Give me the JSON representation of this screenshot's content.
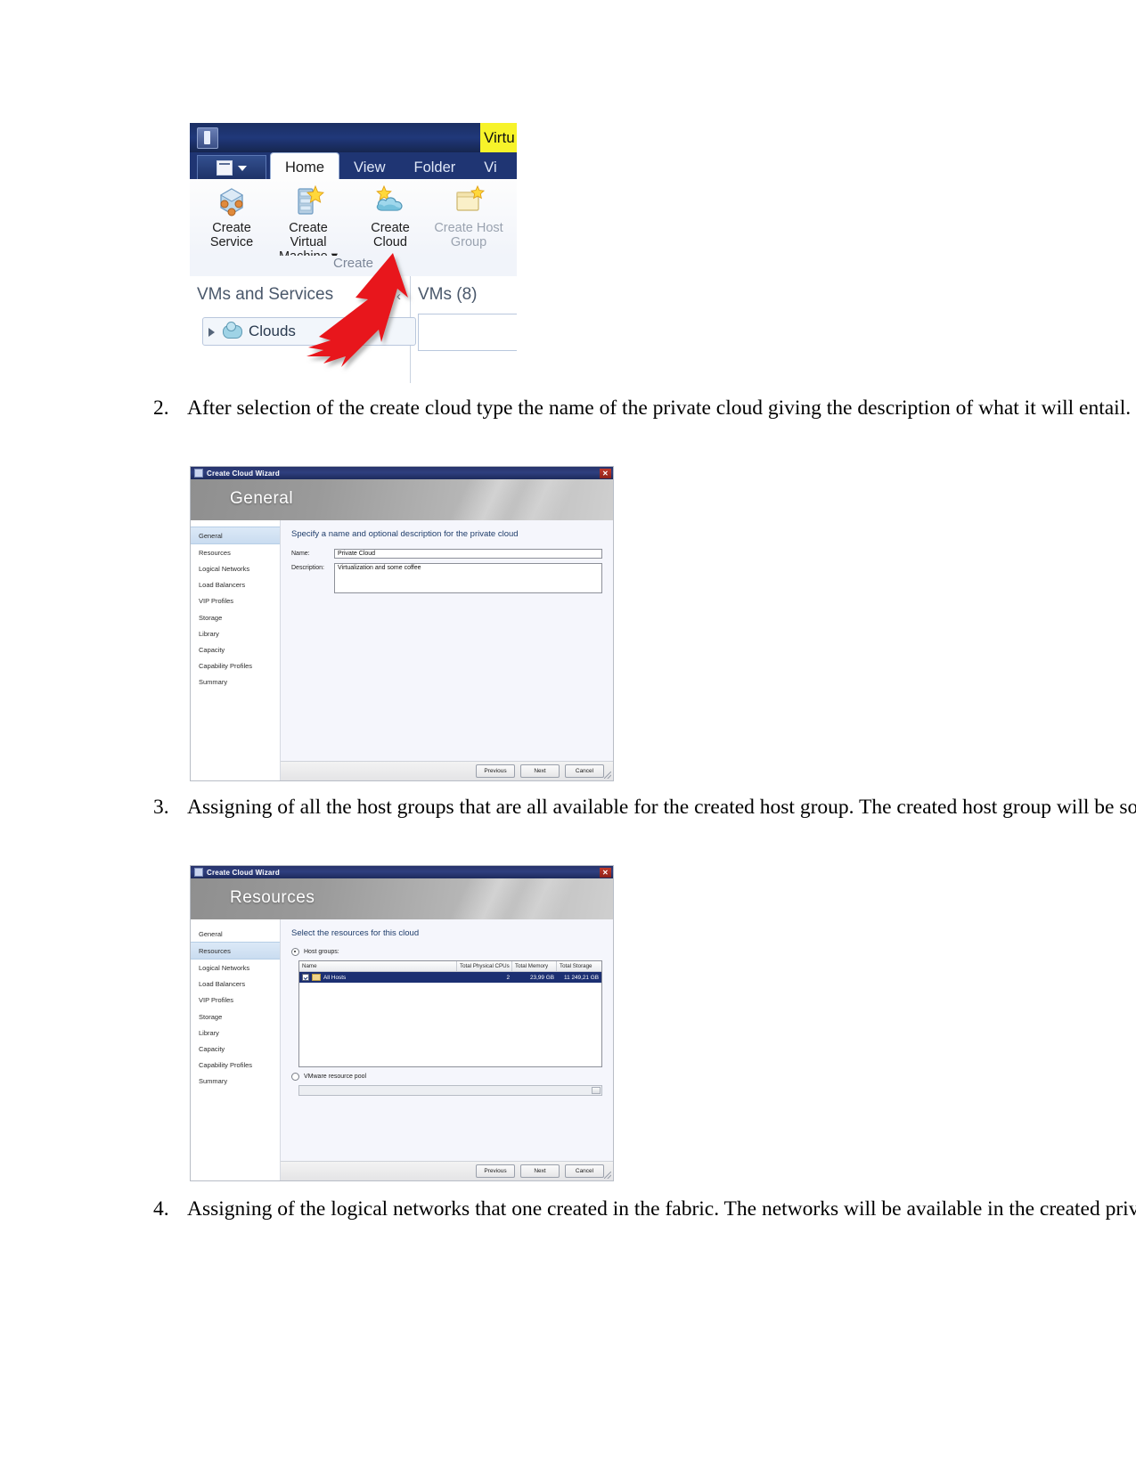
{
  "document": {
    "steps": [
      {
        "number": "2.",
        "text": "After selection of the create cloud type the name of the private cloud giving the description of what it will entail."
      },
      {
        "number": "3.",
        "text": "Assigning of all the host groups that are all available for the created host group. The created host group will be sorted in the fabric"
      },
      {
        "number": "4.",
        "text": "Assigning of the logical networks that one created in the fabric. The networks will be available in the created private cloud."
      }
    ]
  },
  "figure_ribbon": {
    "window_title": "Virtu",
    "app_menu_icon": "list-menu-icon",
    "tabs": [
      {
        "label": "Home",
        "active": true
      },
      {
        "label": "View",
        "active": false
      },
      {
        "label": "Folder",
        "active": false
      },
      {
        "label": "Vi",
        "active": false
      }
    ],
    "commands": [
      {
        "line1": "Create",
        "line2": "Service",
        "icon": "create-service-icon",
        "disabled": false
      },
      {
        "line1": "Create Virtual",
        "line2": "Machine ▾",
        "icon": "create-virtual-machine-icon",
        "disabled": false
      },
      {
        "line1": "Create",
        "line2": "Cloud",
        "icon": "create-cloud-icon",
        "disabled": false
      },
      {
        "line1": "Create Host",
        "line2": "Group",
        "icon": "create-host-group-icon",
        "disabled": true
      }
    ],
    "group_label": "Create",
    "pane_title": "VMs and Services",
    "collapse_chevron": "‹",
    "results_title": "VMs (8)",
    "tree_node": "Clouds",
    "annotation_color": "#e8141a"
  },
  "wizard_general": {
    "title": "Create Cloud Wizard",
    "title_icon": "wizard-window-icon",
    "close_label": "✕",
    "banner": "General",
    "nav": [
      {
        "label": "General",
        "active": true
      },
      {
        "label": "Resources",
        "active": false
      },
      {
        "label": "Logical Networks",
        "active": false
      },
      {
        "label": "Load Balancers",
        "active": false
      },
      {
        "label": "VIP Profiles",
        "active": false
      },
      {
        "label": "Storage",
        "active": false
      },
      {
        "label": "Library",
        "active": false
      },
      {
        "label": "Capacity",
        "active": false
      },
      {
        "label": "Capability Profiles",
        "active": false
      },
      {
        "label": "Summary",
        "active": false
      }
    ],
    "heading": "Specify a name and optional description for the private cloud",
    "fields": {
      "name_label": "Name:",
      "name_value": "Private Cloud",
      "description_label": "Description:",
      "description_value": "Virtualization and some coffee"
    },
    "buttons": {
      "previous": "Previous",
      "next": "Next",
      "cancel": "Cancel"
    }
  },
  "wizard_resources": {
    "title": "Create Cloud Wizard",
    "title_icon": "wizard-window-icon",
    "close_label": "✕",
    "banner": "Resources",
    "nav": [
      {
        "label": "General",
        "active": false
      },
      {
        "label": "Resources",
        "active": true
      },
      {
        "label": "Logical Networks",
        "active": false
      },
      {
        "label": "Load Balancers",
        "active": false
      },
      {
        "label": "VIP Profiles",
        "active": false
      },
      {
        "label": "Storage",
        "active": false
      },
      {
        "label": "Library",
        "active": false
      },
      {
        "label": "Capacity",
        "active": false
      },
      {
        "label": "Capability Profiles",
        "active": false
      },
      {
        "label": "Summary",
        "active": false
      }
    ],
    "heading": "Select the resources for this cloud",
    "options": {
      "host_groups_label": "Host groups:",
      "host_groups_selected": true,
      "vmware_pool_label": "VMware resource pool",
      "vmware_pool_selected": false
    },
    "table": {
      "headers": [
        "Name",
        "Total Physical CPUs",
        "Total Memory",
        "Total Storage"
      ],
      "rows": [
        {
          "name": "All Hosts",
          "checked": true,
          "total_physical_cpus": "2",
          "total_memory": "23,99 GB",
          "total_storage": "11 249,21 GB"
        }
      ]
    },
    "buttons": {
      "previous": "Previous",
      "next": "Next",
      "cancel": "Cancel"
    }
  }
}
